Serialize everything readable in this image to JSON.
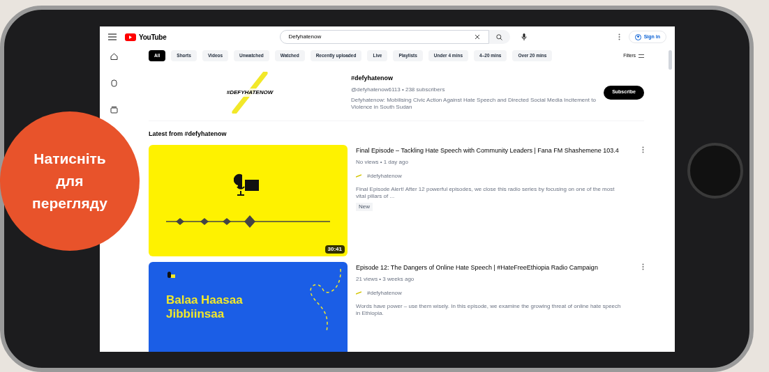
{
  "topbar": {
    "logo": "YouTube",
    "search": {
      "value": "Defyhatenow"
    },
    "sign_in": "Sign in"
  },
  "chips": [
    {
      "label": "All",
      "selected": true
    },
    {
      "label": "Shorts",
      "selected": false
    },
    {
      "label": "Videos",
      "selected": false
    },
    {
      "label": "Unwatched",
      "selected": false
    },
    {
      "label": "Watched",
      "selected": false
    },
    {
      "label": "Recently uploaded",
      "selected": false
    },
    {
      "label": "Live",
      "selected": false
    },
    {
      "label": "Playlists",
      "selected": false
    },
    {
      "label": "Under 4 mins",
      "selected": false
    },
    {
      "label": "4–20 mins",
      "selected": false
    },
    {
      "label": "Over 20 mins",
      "selected": false
    }
  ],
  "filters": "Filters",
  "channel": {
    "banner_text": "#DEFYHATENOW",
    "name": "#defyhatenow",
    "meta": "@defyhatenow6113 • 238 subscribers",
    "description": "Defyhatenow: Mobilising Civic Action Against Hate Speech and Directed Social Media Incitement to Violence in South Sudan",
    "subscribe": "Subscribe"
  },
  "section_title": "Latest from #defyhatenow",
  "videos": [
    {
      "kind": "yellow",
      "title": "Final Episode – Tackling Hate Speech with Community Leaders | Fana FM Shashemene 103.4",
      "meta": "No views • 1 day ago",
      "channel": "#defyhatenow",
      "description": "Final Episode Alert! After 12 powerful episodes, we close this radio series by focusing on one of the most vital pillars of ...",
      "badge": "New",
      "duration": "30:41"
    },
    {
      "kind": "blue",
      "thumb_text": "Balaa Haasaa Jibbiinsaa",
      "title": "Episode 12: The Dangers of Online Hate Speech | #HateFreeEthiopia Radio Campaign",
      "meta": "21 views • 3 weeks ago",
      "channel": "#defyhatenow",
      "description": "Words have power – use them wisely. In this episode, we examine the growing threat of online hate speech in Ethiopia."
    }
  ],
  "overlay_button": "Натисніть для перегляду"
}
